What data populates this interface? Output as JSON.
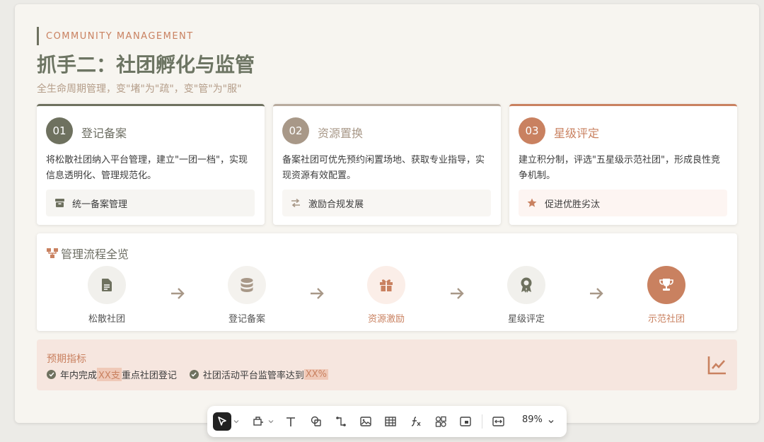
{
  "header": {
    "eyebrow": "COMMUNITY MANAGEMENT",
    "title": "抓手二：社团孵化与监管",
    "subtitle": "全生命周期管理，变\"堵\"为\"疏\"，变\"管\"为\"服\""
  },
  "cards": [
    {
      "num": "01",
      "title": "登记备案",
      "desc": "将松散社团纳入平台管理，建立\"一团一档\"，实现信息透明化、管理规范化。",
      "tag": "统一备案管理",
      "icon": "archive-icon",
      "color": "#6e715f",
      "tag_bg": "#f6f5f2"
    },
    {
      "num": "02",
      "title": "资源置换",
      "desc": "备案社团可优先预约闲置场地、获取专业指导，实现资源有效配置。",
      "tag": "激励合规发展",
      "icon": "exchange-icon",
      "color": "#a89888",
      "tag_bg": "#f8f6f3"
    },
    {
      "num": "03",
      "title": "星级评定",
      "desc": "建立积分制，评选\"五星级示范社团\"，形成良性竞争机制。",
      "tag": "促进优胜劣汰",
      "icon": "star-icon",
      "color": "#c98160",
      "tag_bg": "#fdf5f2"
    }
  ],
  "process": {
    "title": "管理流程全览",
    "steps": [
      {
        "label": "松散社团",
        "icon": "file-icon"
      },
      {
        "label": "登记备案",
        "icon": "database-icon"
      },
      {
        "label": "资源激励",
        "icon": "gift-icon"
      },
      {
        "label": "星级评定",
        "icon": "award-icon"
      },
      {
        "label": "示范社团",
        "icon": "trophy-icon"
      }
    ]
  },
  "metrics": {
    "title": "预期指标",
    "item1_prefix": "年内完成",
    "item1_highlight": "XX支",
    "item1_suffix": "重点社团登记",
    "item2_prefix": "社团活动平台监管率达到",
    "item2_highlight": "XX%"
  },
  "toolbar": {
    "zoom": "89%"
  },
  "colors": {
    "olive": "#6e715f",
    "taupe": "#a89888",
    "terracotta": "#c98160"
  }
}
